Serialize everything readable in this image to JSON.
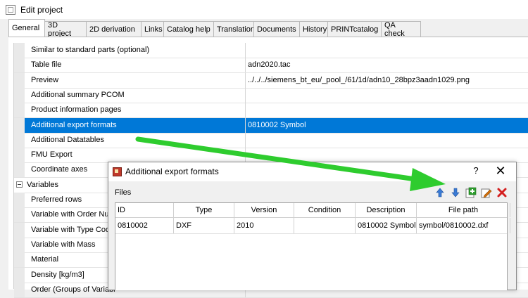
{
  "window": {
    "title": "Edit project"
  },
  "tabs": [
    {
      "label": "General",
      "active": true
    },
    {
      "label": "3D project"
    },
    {
      "label": "2D derivation"
    },
    {
      "label": "Links"
    },
    {
      "label": "Catalog help"
    },
    {
      "label": "Translation"
    },
    {
      "label": "Documents"
    },
    {
      "label": "History"
    },
    {
      "label": "PRINTcatalog"
    },
    {
      "label": "QA check"
    }
  ],
  "properties": [
    {
      "name": "Similar to standard parts (optional)",
      "value": ""
    },
    {
      "name": "Table file",
      "value": "adn2020.tac"
    },
    {
      "name": "Preview",
      "value": "../../../siemens_bt_eu/_pool_/61/1d/adn10_28bpz3aadn1029.png"
    },
    {
      "name": "Additional summary PCOM",
      "value": ""
    },
    {
      "name": "Product information pages",
      "value": ""
    },
    {
      "name": "Additional export formats",
      "value": "0810002 Symbol",
      "selected": true
    },
    {
      "name": "Additional Datatables",
      "value": ""
    },
    {
      "name": "FMU Export",
      "value": ""
    },
    {
      "name": "Coordinate axes",
      "value": ""
    },
    {
      "name": "Variables",
      "value": "",
      "category": true
    },
    {
      "name": "Preferred rows",
      "value": ""
    },
    {
      "name": "Variable with Order Num",
      "value": ""
    },
    {
      "name": "Variable with Type Code",
      "value": ""
    },
    {
      "name": "Variable with Mass",
      "value": ""
    },
    {
      "name": "Material",
      "value": ""
    },
    {
      "name": "Density [kg/m3]",
      "value": ""
    },
    {
      "name": "Order (Groups of Variabl",
      "value": ""
    }
  ],
  "dialog": {
    "title": "Additional export formats",
    "help": "?",
    "close": "✕",
    "files_label": "Files",
    "toolbar": [
      {
        "name": "move-up-icon",
        "color": "#3a7bd5"
      },
      {
        "name": "move-down-icon",
        "color": "#3a7bd5"
      },
      {
        "name": "add-icon",
        "color": "#2e9e2e"
      },
      {
        "name": "edit-icon",
        "color": "#d4700a"
      },
      {
        "name": "delete-icon",
        "color": "#d42020"
      }
    ],
    "columns": [
      "ID",
      "Type",
      "Version",
      "Condition",
      "Description",
      "File path"
    ],
    "rows": [
      [
        "0810002",
        "DXF",
        "2010",
        "",
        "0810002 Symbol",
        "symbol/0810002.dxf"
      ]
    ]
  },
  "colors": {
    "selection": "#0078d7",
    "annotation_arrow": "#2ecc2e"
  }
}
